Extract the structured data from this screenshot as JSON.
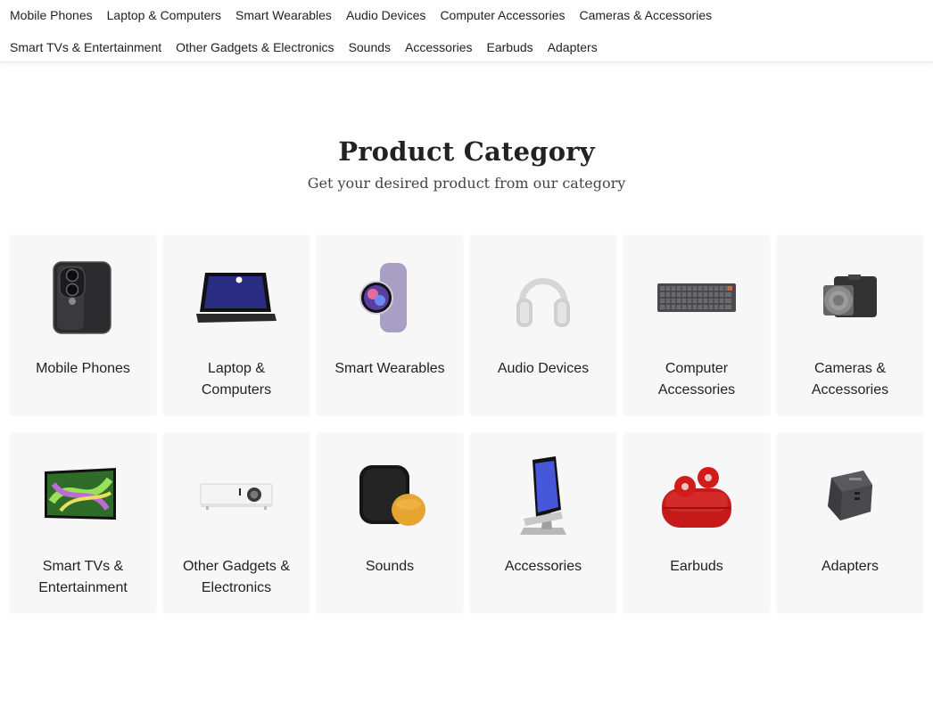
{
  "nav": {
    "row1": [
      "Mobile Phones",
      "Laptop & Computers",
      "Smart Wearables",
      "Audio Devices",
      "Computer Accessories",
      "Cameras & Accessories"
    ],
    "row2": [
      "Smart TVs & Entertainment",
      "Other Gadgets & Electronics",
      "Sounds",
      "Accessories",
      "Earbuds",
      "Adapters"
    ]
  },
  "section": {
    "title": "Product Category",
    "subtitle": "Get your desired product from our category"
  },
  "categories": [
    {
      "label": "Mobile Phones",
      "icon": "smartphone-icon"
    },
    {
      "label": "Laptop & Computers",
      "icon": "laptop-icon"
    },
    {
      "label": "Smart Wearables",
      "icon": "smartwatch-icon"
    },
    {
      "label": "Audio Devices",
      "icon": "headphones-icon"
    },
    {
      "label": "Computer Accessories",
      "icon": "keyboard-icon"
    },
    {
      "label": "Cameras & Accessories",
      "icon": "camera-icon"
    },
    {
      "label": "Smart TVs & Entertainment",
      "icon": "tv-icon"
    },
    {
      "label": "Other Gadgets & Electronics",
      "icon": "projector-icon"
    },
    {
      "label": "Sounds",
      "icon": "smart-speaker-icon"
    },
    {
      "label": "Accessories",
      "icon": "phone-stand-icon"
    },
    {
      "label": "Earbuds",
      "icon": "earbuds-icon"
    },
    {
      "label": "Adapters",
      "icon": "charger-adapter-icon"
    }
  ]
}
